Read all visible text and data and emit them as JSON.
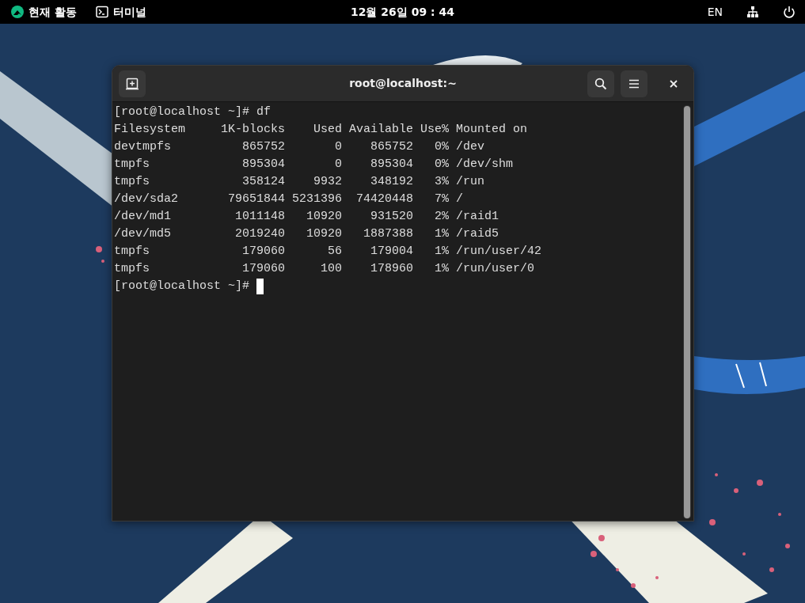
{
  "top_bar": {
    "activities": "현재 활동",
    "app_menu": "터미널",
    "clock": "12월 26일 09 : 44",
    "input_source": "EN"
  },
  "terminal_window": {
    "title": "root@localhost:~",
    "lines": [
      {
        "text": "[root@localhost ~]# df",
        "cursor": false
      },
      {
        "text": "Filesystem     1K-blocks    Used Available Use% Mounted on",
        "cursor": false
      },
      {
        "text": "devtmpfs          865752       0    865752   0% /dev",
        "cursor": false
      },
      {
        "text": "tmpfs             895304       0    895304   0% /dev/shm",
        "cursor": false
      },
      {
        "text": "tmpfs             358124    9932    348192   3% /run",
        "cursor": false
      },
      {
        "text": "/dev/sda2       79651844 5231396  74420448   7% /",
        "cursor": false
      },
      {
        "text": "/dev/md1         1011148   10920    931520   2% /raid1",
        "cursor": false
      },
      {
        "text": "/dev/md5         2019240   10920   1887388   1% /raid5",
        "cursor": false
      },
      {
        "text": "tmpfs             179060      56    179004   1% /run/user/42",
        "cursor": false
      },
      {
        "text": "tmpfs             179060     100    178960   1% /run/user/0",
        "cursor": false
      },
      {
        "text": "[root@localhost ~]#",
        "cursor": true
      }
    ]
  }
}
